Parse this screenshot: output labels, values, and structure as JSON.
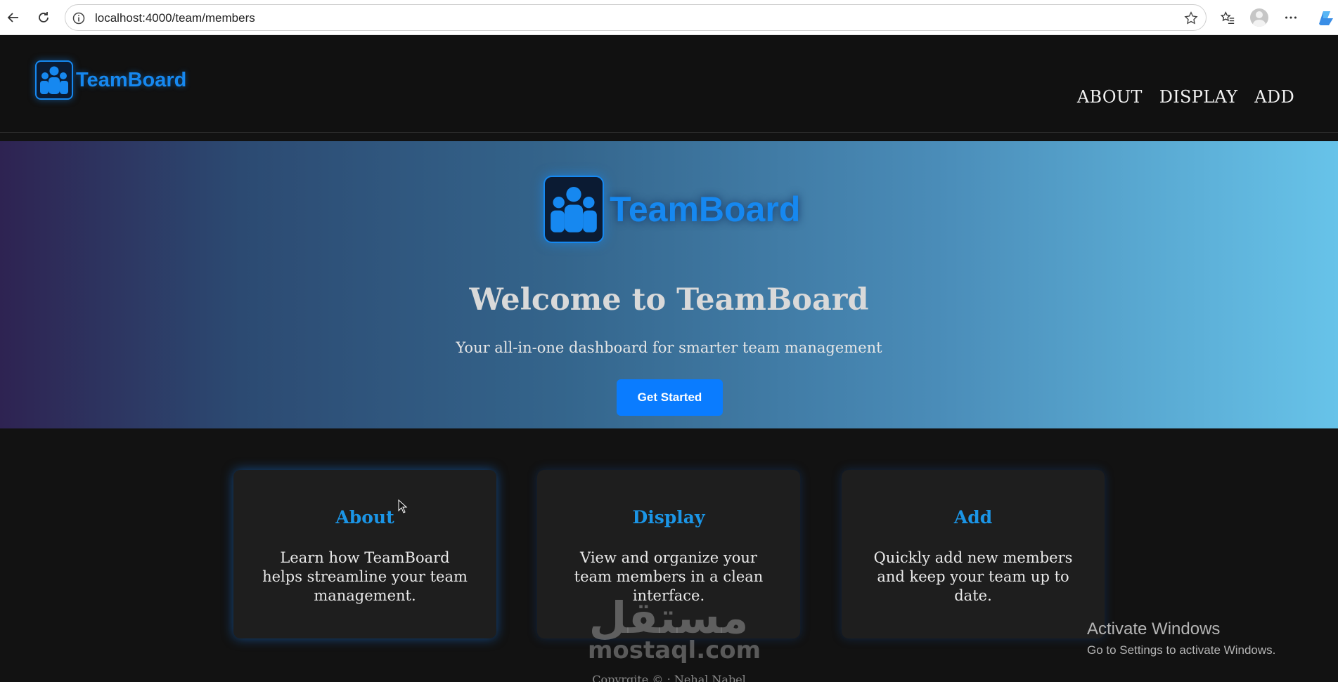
{
  "browser": {
    "url": "localhost:4000/team/members"
  },
  "header": {
    "logo_text": "TeamBoard",
    "nav": [
      "ABOUT",
      "DISPLAY",
      "ADD"
    ]
  },
  "hero": {
    "logo_text": "TeamBoard",
    "title": "Welcome to TeamBoard",
    "subtitle": "Your all-in-one dashboard for smarter team management",
    "cta_label": "Get Started"
  },
  "cards": [
    {
      "title": "About",
      "text": "Learn how TeamBoard helps streamline your team management."
    },
    {
      "title": "Display",
      "text": "View and organize your team members in a clean interface."
    },
    {
      "title": "Add",
      "text": "Quickly add new members and keep your team up to date."
    }
  ],
  "footer": {
    "text": "Copyrgite © : Nehal Nabel"
  },
  "watermark": {
    "arabic": "مستقل",
    "latin": "mostaql.com"
  },
  "os_notice": {
    "title": "Activate Windows",
    "subtitle": "Go to Settings to activate Windows."
  },
  "colors": {
    "accent": "#1688f0",
    "cta": "#0a7cff",
    "card_title": "#1b95e6"
  }
}
